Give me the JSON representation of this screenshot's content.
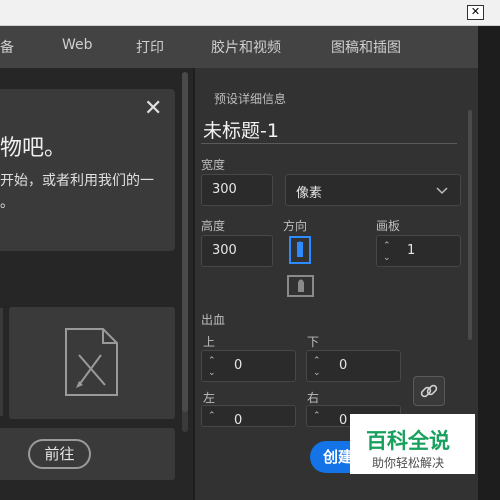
{
  "window": {
    "close_glyph": "✕"
  },
  "tabs": [
    {
      "label": "备"
    },
    {
      "label": "Web"
    },
    {
      "label": "打印"
    },
    {
      "label": "胶片和视频"
    },
    {
      "label": "图稿和插图"
    }
  ],
  "welcome": {
    "close_glyph": "✕",
    "title": "物吧。",
    "line1": "开始，或者利用我们的一",
    "line2": "。"
  },
  "bottom": {
    "go_label": "前往"
  },
  "preset": {
    "header": "预设详细信息",
    "doc_name": "未标题-1",
    "width_label": "宽度",
    "width_value": "300",
    "unit_value": "像素",
    "height_label": "高度",
    "height_value": "300",
    "orientation_label": "方向",
    "artboard_label": "画板",
    "artboard_value": "1",
    "bleed_label": "出血",
    "top_label": "上",
    "top_value": "0",
    "bottom_label": "下",
    "bottom_value": "0",
    "left_label": "左",
    "left_value": "0",
    "right_label": "右",
    "right_value": "0",
    "create_label": "创建"
  },
  "watermark": {
    "title": "百科全说",
    "subtitle": "助你轻松解决"
  },
  "colors": {
    "accent": "#1473e6",
    "orientation_selected": "#2e8bff",
    "watermark_green": "#18a05e"
  }
}
